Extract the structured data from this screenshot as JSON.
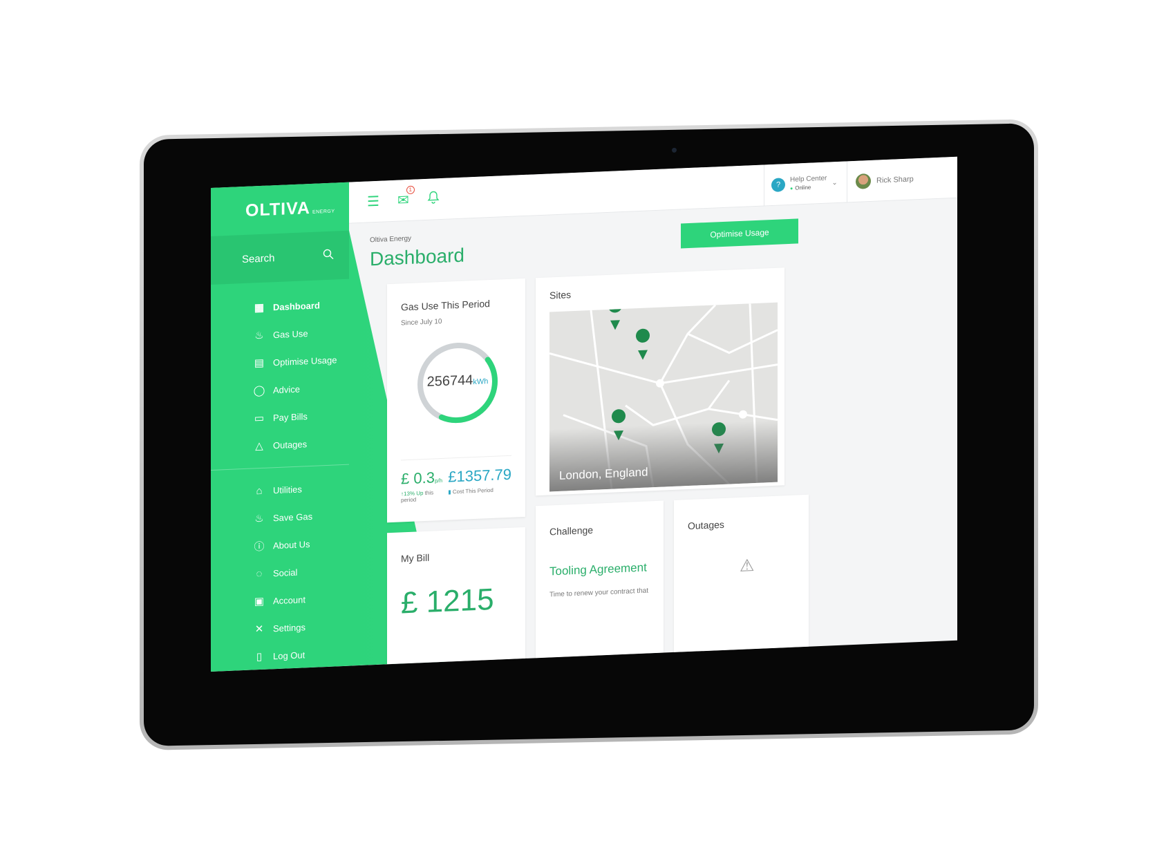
{
  "brand": {
    "name": "OLTIVA",
    "suffix": "ENERGY"
  },
  "search": {
    "label": "Search"
  },
  "menu": {
    "primary": [
      {
        "label": "Dashboard",
        "icon": "grid-icon"
      },
      {
        "label": "Gas Use",
        "icon": "flame-icon"
      },
      {
        "label": "Optimise Usage",
        "icon": "clipboard-icon"
      },
      {
        "label": "Advice",
        "icon": "bulb-icon"
      },
      {
        "label": "Pay Bills",
        "icon": "wallet-icon"
      },
      {
        "label": "Outages",
        "icon": "warning-icon"
      }
    ],
    "secondary": [
      {
        "label": "Utilities",
        "icon": "home-icon"
      },
      {
        "label": "Save Gas",
        "icon": "flame-icon"
      },
      {
        "label": "About Us",
        "icon": "info-icon"
      },
      {
        "label": "Social",
        "icon": "chat-icon"
      },
      {
        "label": "Account",
        "icon": "account-icon"
      },
      {
        "label": "Settings",
        "icon": "tools-icon"
      },
      {
        "label": "Log Out",
        "icon": "logout-icon"
      }
    ]
  },
  "topbar": {
    "mail_badge": "1",
    "help": {
      "label": "Help Center",
      "status": "Online"
    },
    "user": {
      "name": "Rick Sharp"
    }
  },
  "page": {
    "breadcrumb": "Oltiva Energy",
    "title": "Dashboard",
    "action_button": "Optimise Usage"
  },
  "gas_card": {
    "title": "Gas Use This Period",
    "subtitle": "Since July 10",
    "value": "256744",
    "unit": "kWh",
    "progress": 0.42,
    "rate_value": "£ 0.3",
    "rate_unit": "p/h",
    "rate_change": "13% Up",
    "rate_caption": "this period",
    "cost_value": "£1357.79",
    "cost_caption": "Cost This Period"
  },
  "sites_card": {
    "title": "Sites",
    "location": "London, England",
    "pins": [
      "1",
      "2",
      "3",
      "4"
    ]
  },
  "bill_card": {
    "title": "My Bill",
    "value": "£ 1215"
  },
  "challenge_card": {
    "title": "Challenge",
    "headline": "Tooling Agreement",
    "text": "Time to renew your contract that"
  },
  "outages_card": {
    "title": "Outages"
  },
  "colors": {
    "accent": "#2ed47b",
    "accent_dark": "#2aae6a",
    "teal": "#2aa7c4"
  }
}
